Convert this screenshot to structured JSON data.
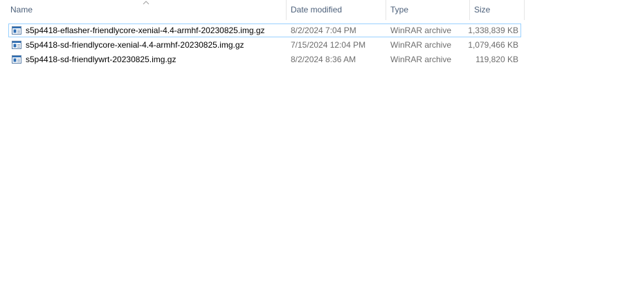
{
  "columns": {
    "name": "Name",
    "date_modified": "Date modified",
    "type": "Type",
    "size": "Size"
  },
  "files": [
    {
      "name": "s5p4418-eflasher-friendlycore-xenial-4.4-armhf-20230825.img.gz",
      "date": "8/2/2024 7:04 PM",
      "type": "WinRAR archive",
      "size": "1,338,839 KB",
      "icon": "winrar-archive-icon"
    },
    {
      "name": "s5p4418-sd-friendlycore-xenial-4.4-armhf-20230825.img.gz",
      "date": "7/15/2024 12:04 PM",
      "type": "WinRAR archive",
      "size": "1,079,466 KB",
      "icon": "winrar-archive-icon"
    },
    {
      "name": "s5p4418-sd-friendlywrt-20230825.img.gz",
      "date": "8/2/2024 8:36 AM",
      "type": "WinRAR archive",
      "size": "119,820 KB",
      "icon": "winrar-archive-icon"
    }
  ],
  "colors": {
    "header_text": "#4c607a",
    "secondary_text": "#6d6d6d",
    "focus_border": "#99d1ff"
  }
}
